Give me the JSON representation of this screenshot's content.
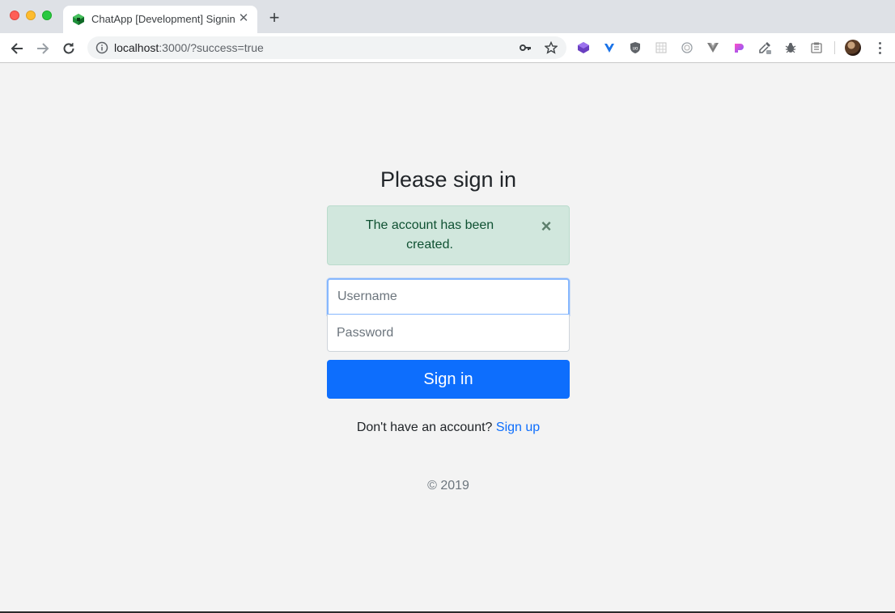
{
  "browser": {
    "tab": {
      "title": "ChatApp [Development] Signin",
      "close_glyph": "✕"
    },
    "new_tab_glyph": "+",
    "address": {
      "host": "localhost",
      "rest": ":3000/?success=true"
    },
    "extensions": [
      "gem-icon",
      "vue-shield-icon",
      "ublock-icon",
      "grid-ext-icon",
      "target-ext-icon",
      "vuejs-devtools-icon",
      "gradient-ext-icon",
      "eyedropper-icon",
      "bug-icon",
      "clipboard-ext-icon"
    ]
  },
  "signin": {
    "heading": "Please sign in",
    "alert": {
      "message": "The account has been created.",
      "close_glyph": "×",
      "color": "#d1e7dd"
    },
    "username_placeholder": "Username",
    "password_placeholder": "Password",
    "submit_label": "Sign in",
    "signup_prompt": "Don't have an account?",
    "signup_link": "Sign up",
    "footer": "© 2019",
    "accent_color": "#0d6efd"
  }
}
